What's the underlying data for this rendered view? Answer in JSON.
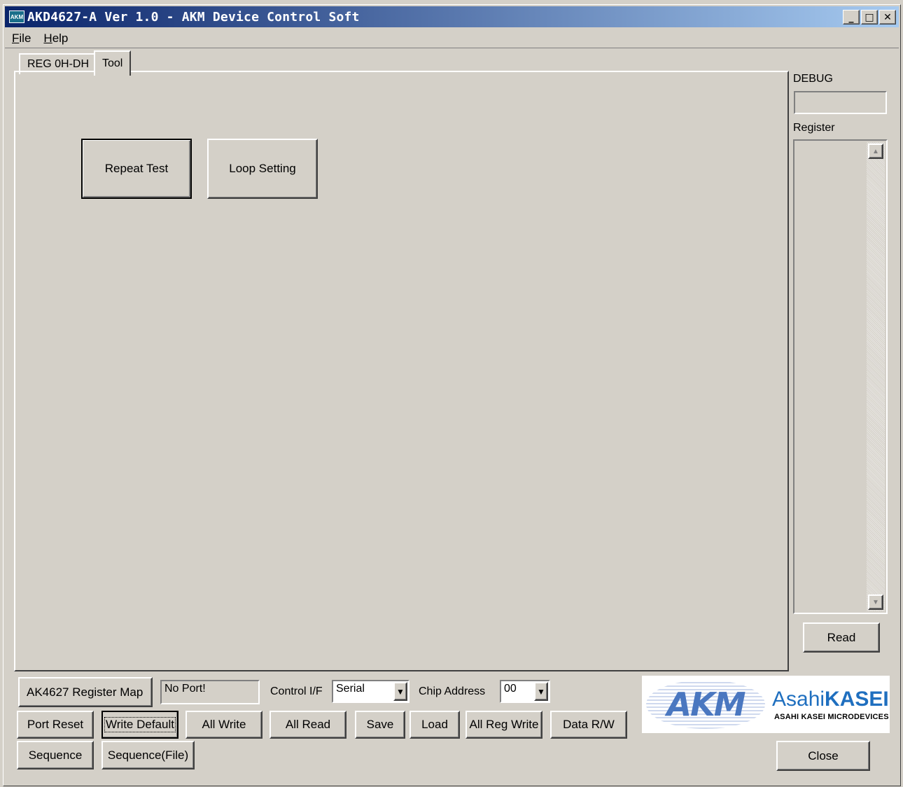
{
  "window": {
    "title": "AKD4627-A Ver 1.0 - AKM Device Control Soft",
    "icon_text": "AKM",
    "controls": {
      "minimize": "_",
      "maximize": "□",
      "close": "✕"
    }
  },
  "menu": {
    "file": {
      "accel": "F",
      "rest": "ile"
    },
    "help": {
      "accel": "H",
      "rest": "elp"
    }
  },
  "tabs": [
    {
      "label": "REG 0H-DH",
      "selected": false
    },
    {
      "label": "Tool",
      "selected": true
    }
  ],
  "tool_panel": {
    "repeat_test": "Repeat Test",
    "loop_setting": "Loop Setting"
  },
  "side": {
    "debug_label": "DEBUG",
    "debug_value": "",
    "register_label": "Register",
    "read_button": "Read"
  },
  "bottom": {
    "register_map": "AK4627 Register Map",
    "port_status": "No Port!",
    "control_if_label": "Control I/F",
    "control_if_value": "Serial",
    "chip_address_label": "Chip Address",
    "chip_address_value": "00",
    "buttons_row1": [
      "Port Reset",
      "Write Default",
      "All Write",
      "All Read",
      "Save",
      "Load",
      "All Reg Write",
      "Data R/W"
    ],
    "sequence": "Sequence",
    "sequence_file": "Sequence(File)",
    "close": "Close"
  },
  "logo": {
    "akm": "AKM",
    "asahi_light": "Asahi",
    "asahi_bold": "KASEI",
    "sub": "ASAHI KASEI MICRODEVICES"
  },
  "colors": {
    "face": "#d4d0c8",
    "title_start": "#0a246a",
    "title_end": "#a6caf0",
    "asahi_blue": "#1f6fbf",
    "akm_blue": "#4a77c0"
  }
}
